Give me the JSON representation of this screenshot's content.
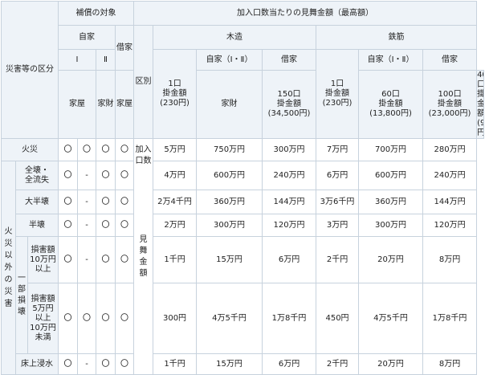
{
  "headers": {
    "category": "災害等の区分",
    "compensation": "補償の対象",
    "self_home": "自家",
    "one": "Ⅰ",
    "two": "Ⅱ",
    "rental": "借家",
    "division": "区別",
    "per_unit": "加入口数当たりの見舞金額（最高額）",
    "wood": "木造",
    "steel": "鉄筋",
    "self_1_2": "自家（Ⅰ・Ⅱ）",
    "rent_short": "借家",
    "house": "家屋",
    "goods": "家財",
    "units": "加入口数",
    "mimai": "見舞金額"
  },
  "unit_headers": {
    "wood_1": "1口\n掛金額\n(230円)",
    "wood_150": "150口\n掛金額\n(34,500円)",
    "wood_60": "60口\n掛金額\n(13,800円)",
    "steel_1": "1口\n掛金額\n(230円)",
    "steel_100": "100口\n掛金額\n(23,000円)",
    "steel_40": "40口\n掛金額\n(9,200円)"
  },
  "side": {
    "other_disasters": "火災以外の災害",
    "partial": "一部損壊"
  },
  "rows": [
    {
      "label": "火災",
      "c1": "〇",
      "c2": "〇",
      "c3": "〇",
      "c4": "〇",
      "v1": "5万円",
      "v2": "750万円",
      "v3": "300万円",
      "v4": "7万円",
      "v5": "700万円",
      "v6": "280万円"
    },
    {
      "label": "全壊・\n全流失",
      "c1": "〇",
      "c2": "-",
      "c3": "〇",
      "c4": "〇",
      "v1": "4万円",
      "v2": "600万円",
      "v3": "240万円",
      "v4": "6万円",
      "v5": "600万円",
      "v6": "240万円"
    },
    {
      "label": "大半壊",
      "c1": "〇",
      "c2": "-",
      "c3": "〇",
      "c4": "〇",
      "v1": "2万4千円",
      "v2": "360万円",
      "v3": "144万円",
      "v4": "3万6千円",
      "v5": "360万円",
      "v6": "144万円"
    },
    {
      "label": "半壊",
      "c1": "〇",
      "c2": "-",
      "c3": "〇",
      "c4": "〇",
      "v1": "2万円",
      "v2": "300万円",
      "v3": "120万円",
      "v4": "3万円",
      "v5": "300万円",
      "v6": "120万円"
    },
    {
      "label": "損害額\n10万円\n以上",
      "c1": "〇",
      "c2": "-",
      "c3": "〇",
      "c4": "〇",
      "v1": "1千円",
      "v2": "15万円",
      "v3": "6万円",
      "v4": "2千円",
      "v5": "20万円",
      "v6": "8万円"
    },
    {
      "label": "損害額\n5万円\n以上\n10万円\n未満",
      "c1": "〇",
      "c2": "〇",
      "c3": "〇",
      "c4": "〇",
      "v1": "300円",
      "v2": "4万5千円",
      "v3": "1万8千円",
      "v4": "450円",
      "v5": "4万5千円",
      "v6": "1万8千円"
    },
    {
      "label": "床上浸水",
      "c1": "〇",
      "c2": "-",
      "c3": "〇",
      "c4": "〇",
      "v1": "1千円",
      "v2": "15万円",
      "v3": "6万円",
      "v4": "2千円",
      "v5": "20万円",
      "v6": "8万円"
    }
  ]
}
